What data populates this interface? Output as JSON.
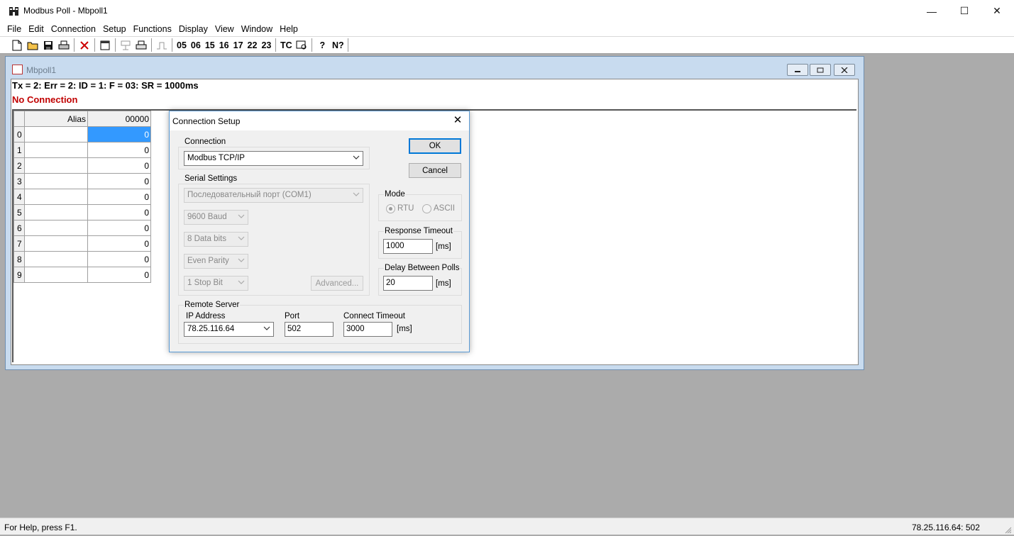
{
  "window": {
    "title": "Modbus Poll - Mbpoll1",
    "minimize": "—",
    "maximize": "☐",
    "close": "✕"
  },
  "menu": [
    "File",
    "Edit",
    "Connection",
    "Setup",
    "Functions",
    "Display",
    "View",
    "Window",
    "Help"
  ],
  "toolbar": {
    "function_codes": [
      "05",
      "06",
      "15",
      "16",
      "17",
      "22",
      "23"
    ],
    "tc_label": "TC",
    "help_label": "?",
    "context_help_label": "N?"
  },
  "child": {
    "title": "Mbpoll1",
    "status_line": "Tx = 2: Err = 2: ID = 1: F = 03: SR = 1000ms",
    "connection_status": "No Connection",
    "grid": {
      "alias_header": "Alias",
      "col_header": "00000",
      "rows": [
        {
          "n": "0",
          "value": "0"
        },
        {
          "n": "1",
          "value": "0"
        },
        {
          "n": "2",
          "value": "0"
        },
        {
          "n": "3",
          "value": "0"
        },
        {
          "n": "4",
          "value": "0"
        },
        {
          "n": "5",
          "value": "0"
        },
        {
          "n": "6",
          "value": "0"
        },
        {
          "n": "7",
          "value": "0"
        },
        {
          "n": "8",
          "value": "0"
        },
        {
          "n": "9",
          "value": "0"
        }
      ]
    }
  },
  "dialog": {
    "title": "Connection Setup",
    "connection_group": "Connection",
    "connection_value": "Modbus TCP/IP",
    "serial_group": "Serial Settings",
    "serial_port": "Последовательный порт (COM1)",
    "baud": "9600 Baud",
    "data_bits": "8 Data bits",
    "parity": "Even Parity",
    "stop_bits": "1 Stop Bit",
    "advanced_button": "Advanced...",
    "ok_button": "OK",
    "cancel_button": "Cancel",
    "mode_group": "Mode",
    "mode_rtu": "RTU",
    "mode_ascii": "ASCII",
    "response_timeout_group": "Response Timeout",
    "response_timeout_value": "1000",
    "ms_unit": "[ms]",
    "delay_group": "Delay Between Polls",
    "delay_value": "20",
    "remote_group": "Remote Server",
    "ip_label": "IP Address",
    "ip_value": "78.25.116.64",
    "port_label": "Port",
    "port_value": "502",
    "connect_timeout_label": "Connect Timeout",
    "connect_timeout_value": "3000"
  },
  "statusbar": {
    "help_text": "For Help, press F1.",
    "address": "78.25.116.64: 502"
  }
}
